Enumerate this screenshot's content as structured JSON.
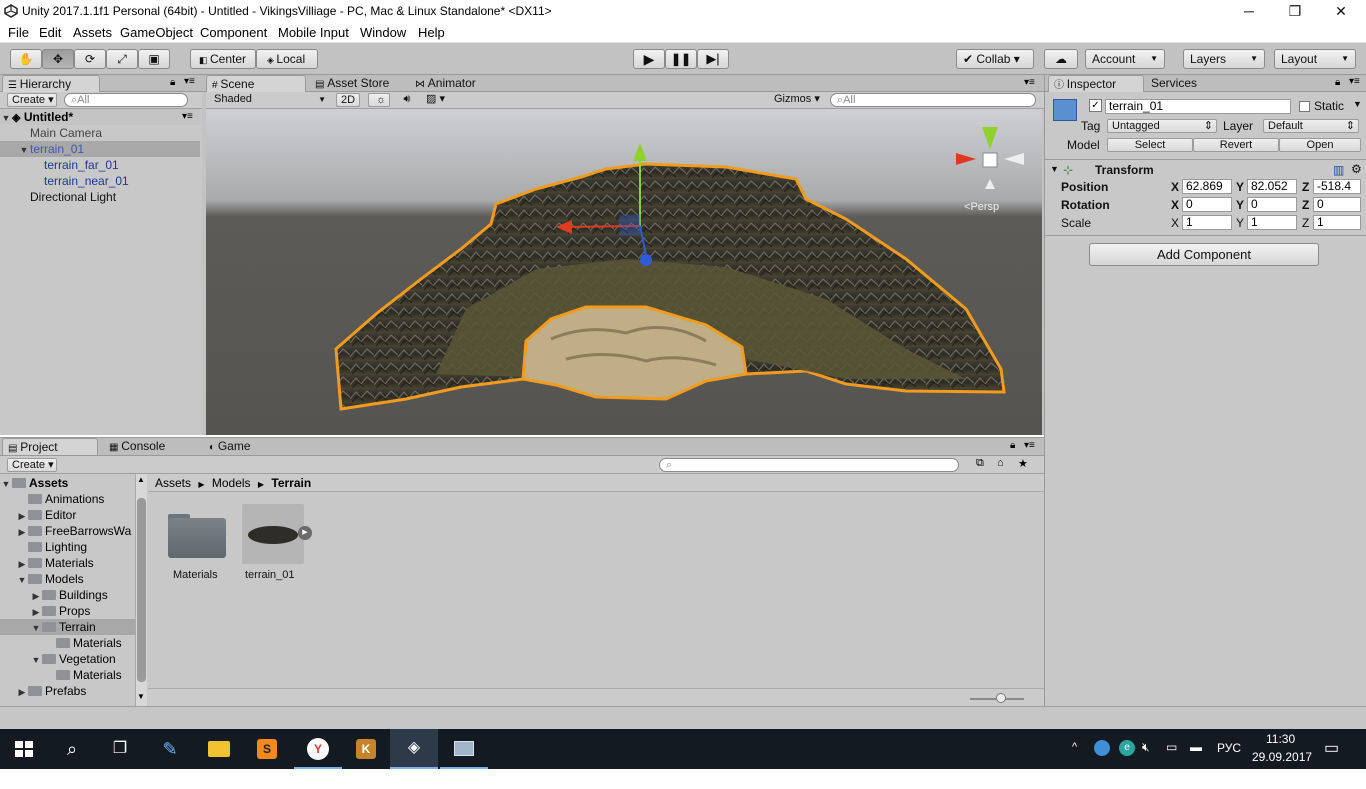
{
  "window": {
    "title": "Unity 2017.1.1f1 Personal (64bit) - Untitled - VikingsVilliage - PC, Mac & Linux Standalone* <DX11>",
    "min": "─",
    "max": "❐",
    "close": "✕"
  },
  "menu": [
    "File",
    "Edit",
    "Assets",
    "GameObject",
    "Component",
    "Mobile Input",
    "Window",
    "Help"
  ],
  "toolbar": {
    "pivot": "Center",
    "space": "Local",
    "collab": "Collab ▾",
    "account": "Account",
    "layers": "Layers",
    "layout": "Layout"
  },
  "hierarchy": {
    "tab": "Hierarchy",
    "create": "Create",
    "search_placeholder": "All",
    "scene": "Untitled*",
    "items": [
      {
        "label": "Main Camera"
      },
      {
        "label": "terrain_01"
      },
      {
        "label": "terrain_far_01"
      },
      {
        "label": "terrain_near_01"
      },
      {
        "label": "Directional Light"
      }
    ]
  },
  "scene_view": {
    "tabs": [
      "Scene",
      "Asset Store",
      "Animator"
    ],
    "shading": "Shaded",
    "mode2d": "2D",
    "gizmos": "Gizmos",
    "search_placeholder": "All",
    "persp": "Persp",
    "selection_color": "#f29b1e"
  },
  "inspector": {
    "tabs": [
      "Inspector",
      "Services"
    ],
    "object_name": "terrain_01",
    "static": "Static",
    "tag_label": "Tag",
    "tag_value": "Untagged",
    "layer_label": "Layer",
    "layer_value": "Default",
    "model_label": "Model",
    "model_buttons": [
      "Select",
      "Revert",
      "Open"
    ],
    "transform": {
      "title": "Transform",
      "position": {
        "label": "Position",
        "x": "62.869",
        "y": "82.052",
        "z": "-518.4"
      },
      "rotation": {
        "label": "Rotation",
        "x": "0",
        "y": "0",
        "z": "0"
      },
      "scale": {
        "label": "Scale",
        "x": "1",
        "y": "1",
        "z": "1"
      }
    },
    "add_component": "Add Component"
  },
  "project": {
    "tabs": [
      "Project",
      "Console",
      "Game"
    ],
    "create": "Create",
    "breadcrumb": [
      "Assets",
      "Models",
      "Terrain"
    ],
    "tree": [
      {
        "label": "Assets",
        "depth": 0,
        "arrow": "▼"
      },
      {
        "label": "Animations",
        "depth": 1,
        "arrow": ""
      },
      {
        "label": "Editor",
        "depth": 1,
        "arrow": "▶"
      },
      {
        "label": "FreeBarrowsWa",
        "depth": 1,
        "arrow": "▶"
      },
      {
        "label": "Lighting",
        "depth": 1,
        "arrow": ""
      },
      {
        "label": "Materials",
        "depth": 1,
        "arrow": "▶"
      },
      {
        "label": "Models",
        "depth": 1,
        "arrow": "▼"
      },
      {
        "label": "Buildings",
        "depth": 2,
        "arrow": "▶"
      },
      {
        "label": "Props",
        "depth": 2,
        "arrow": "▶"
      },
      {
        "label": "Terrain",
        "depth": 2,
        "arrow": "▼"
      },
      {
        "label": "Materials",
        "depth": 3,
        "arrow": ""
      },
      {
        "label": "Vegetation",
        "depth": 2,
        "arrow": "▼"
      },
      {
        "label": "Materials",
        "depth": 3,
        "arrow": ""
      },
      {
        "label": "Prefabs",
        "depth": 1,
        "arrow": "▶"
      }
    ],
    "assets": [
      {
        "label": "Materials"
      },
      {
        "label": "terrain_01"
      }
    ]
  },
  "taskbar": {
    "lang": "РУС",
    "time": "11:30",
    "date": "29.09.2017"
  }
}
